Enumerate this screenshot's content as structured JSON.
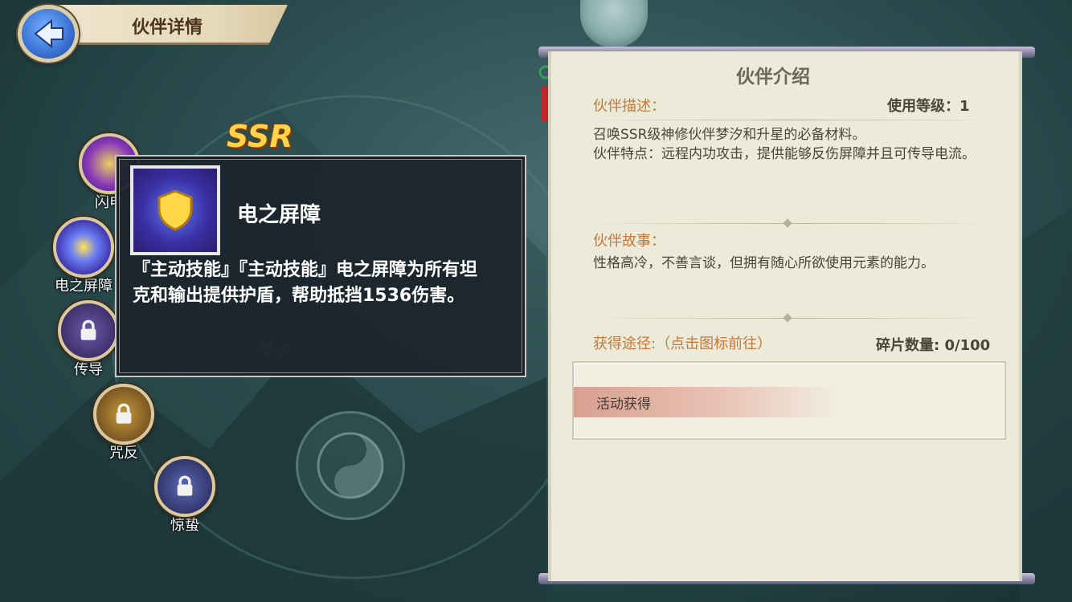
{
  "header": {
    "title": "伙伴详情"
  },
  "center": {
    "rarity": "SSR",
    "partner_name": "梦汐"
  },
  "skills": [
    {
      "label": "闪电",
      "icon": "lightning-orb-icon",
      "locked": false
    },
    {
      "label": "电之屏障",
      "icon": "shield-orb-icon",
      "locked": false
    },
    {
      "label": "传导",
      "icon": "lock-icon",
      "locked": true
    },
    {
      "label": "咒反",
      "icon": "lock-icon",
      "locked": true
    },
    {
      "label": "惊蛰",
      "icon": "lock-icon",
      "locked": true
    }
  ],
  "tooltip": {
    "title": "电之屏障",
    "description": "『主动技能』『主动技能』电之屏障为所有坦克和输出提供护盾，帮助抵挡1536伤害。"
  },
  "panel": {
    "title": "伙伴介绍",
    "desc_label": "伙伴描述：",
    "use_level": "使用等级：1",
    "desc_line1": "召唤SSR级神修伙伴梦汐和升星的必备材料。",
    "desc_line2": "伙伴特点：远程内功攻击，提供能够反伤屏障并且可传导电流。",
    "story_label": "伙伴故事：",
    "story_text": "性格高冷，不善言谈，但拥有随心所欲使用元素的能力。",
    "source_label": "获得途径:（点击图标前往）",
    "fragments": "碎片数量: 0/100",
    "sources": [
      "活动获得"
    ]
  },
  "colors": {
    "accent_orange": "#c6783a",
    "panel_bg": "#ecead9",
    "tooltip_bg": "#1c242c",
    "ssr_gold": "#ffd34a"
  }
}
